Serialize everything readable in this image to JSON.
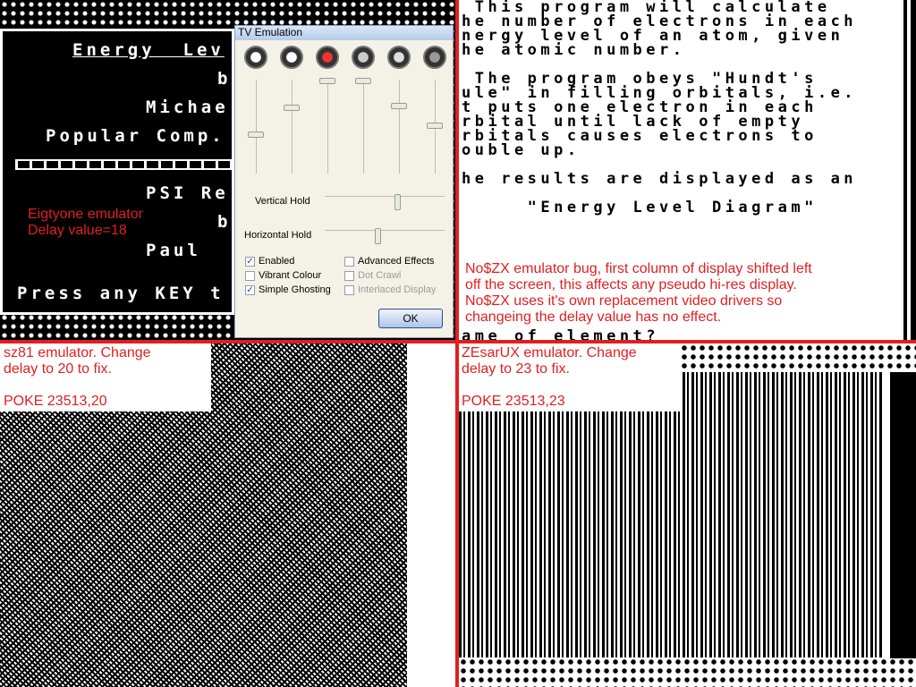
{
  "top_left": {
    "screen_lines": [
      "Energy  Lev",
      "b",
      "Michae",
      "Popular Comp.",
      "PSI Re",
      "b",
      "Paul",
      "Press any KEY t"
    ],
    "annotation": [
      "Eigtyone emulator",
      "Delay value=18"
    ]
  },
  "dialog": {
    "title": "TV Emulation",
    "icons": [
      "brightness-icon",
      "contrast-icon",
      "colour-icon",
      "noise-icon",
      "sharpness-icon",
      "scanlines-icon"
    ],
    "vertical_slider_levels": [
      0.6,
      0.3,
      0.0,
      0.0,
      0.28,
      0.5
    ],
    "vertical_hold_label": "Vertical Hold",
    "vertical_hold_value": 0.58,
    "horizontal_hold_label": "Horizontal Hold",
    "horizontal_hold_value": 0.42,
    "checkboxes": [
      {
        "label": "Enabled",
        "checked": true,
        "enabled": true
      },
      {
        "label": "Vibrant Colour",
        "checked": false,
        "enabled": true
      },
      {
        "label": "Simple Ghosting",
        "checked": true,
        "enabled": true
      },
      {
        "label": "Advanced Effects",
        "checked": false,
        "enabled": true
      },
      {
        "label": "Dot Crawl",
        "checked": false,
        "enabled": false
      },
      {
        "label": "Interlaced Display",
        "checked": false,
        "enabled": false
      }
    ],
    "ok_label": "OK"
  },
  "top_right": {
    "screen_lines": [
      " This program will calculate",
      "he number of electrons in each",
      "nergy level of an atom, given",
      "he atomic number.",
      "",
      " The program obeys \"Hundt's",
      "ule\" in filling orbitals, i.e.",
      "t puts one electron in each",
      "rbital until lack of empty",
      "rbitals causes electrons to",
      "ouble up.",
      "",
      "he results are displayed as an",
      "",
      "     \"Energy Level Diagram\""
    ],
    "prompt": "ame of element?",
    "annotation": [
      "No$ZX emulator bug, first column of display shifted left",
      "off the screen, this affects any pseudo hi-res display.",
      "No$ZX uses it's own replacement video drivers so",
      "changeing the delay value has no effect."
    ]
  },
  "bottom_left": {
    "annotation": [
      "sz81 emulator. Change",
      "delay to 20 to fix.",
      "",
      "POKE 23513,20"
    ]
  },
  "bottom_right": {
    "annotation": [
      "ZEsarUX emulator. Change",
      "delay to 23 to fix.",
      "",
      "POKE 23513,23"
    ]
  },
  "colors": {
    "divider": "#e02020",
    "annotation": "#e02020"
  }
}
